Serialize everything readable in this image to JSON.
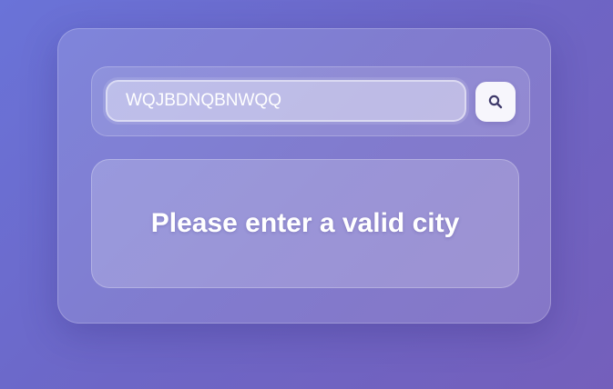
{
  "search": {
    "value": "WQJBDNQBNWQQ",
    "button_icon": "search-icon"
  },
  "message": {
    "text": "Please enter a valid city"
  },
  "colors": {
    "background_start": "#6a73d8",
    "background_end": "#745fbb",
    "button_bg": "#f7f6fc",
    "icon_color": "#3f3a6b",
    "text": "#ffffff"
  }
}
